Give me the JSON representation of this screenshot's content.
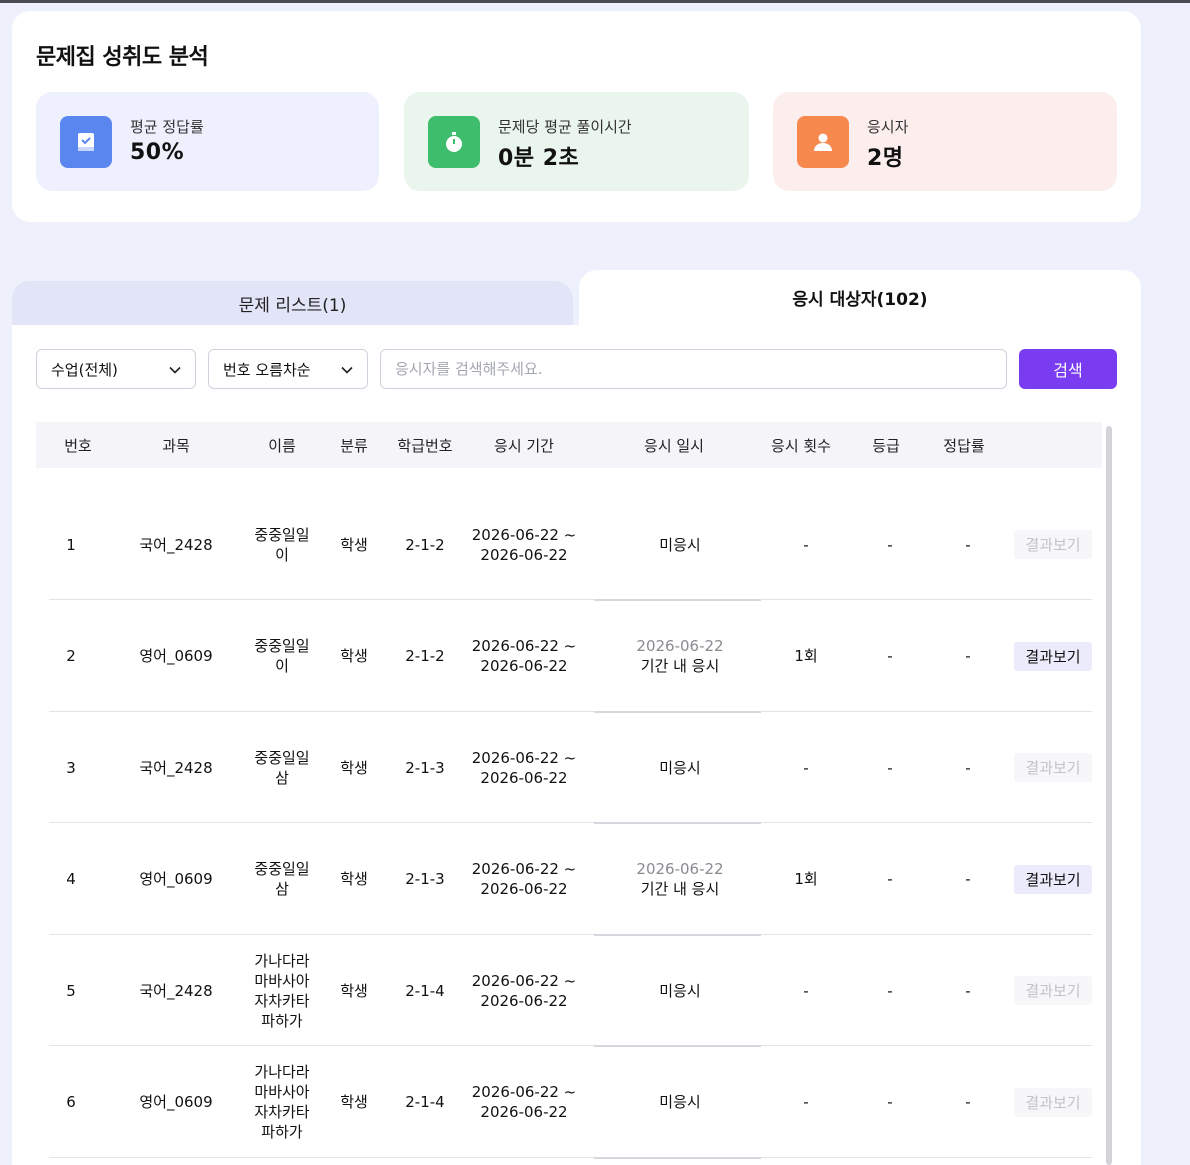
{
  "summary": {
    "title": "문제집 성취도 분석",
    "stats": [
      {
        "label": "평균 정답률",
        "value": "50%",
        "icon": "book-check-icon",
        "color": "#5a86f0"
      },
      {
        "label": "문제당 평균 풀이시간",
        "value": "0분 2초",
        "icon": "stopwatch-icon",
        "color": "#3ebd6c"
      },
      {
        "label": "응시자",
        "value": "2명",
        "icon": "person-icon",
        "color": "#f7884e"
      }
    ]
  },
  "tabs": [
    {
      "label": "문제 리스트(1)",
      "active": false
    },
    {
      "label": "응시 대상자(102)",
      "active": true
    }
  ],
  "filters": {
    "class_select": "수업(전체)",
    "sort_select": "번호 오름차순",
    "search_placeholder": "응시자를 검색해주세요.",
    "search_button": "검색"
  },
  "table": {
    "columns": [
      "번호",
      "과목",
      "이름",
      "분류",
      "학급번호",
      "응시 기간",
      "응시 일시",
      "응시 횟수",
      "등급",
      "정답률"
    ],
    "result_label": "결과보기",
    "rows": [
      {
        "no": "1",
        "subject": "국어_2428",
        "name": [
          "중중일일",
          "이"
        ],
        "type": "학생",
        "class_no": "2-1-2",
        "period": [
          "2026-06-22 ~",
          "2026-06-22"
        ],
        "taken": [
          "미응시"
        ],
        "taken_muted": false,
        "count": "-",
        "grade": "-",
        "rate": "-",
        "result_enabled": false
      },
      {
        "no": "2",
        "subject": "영어_0609",
        "name": [
          "중중일일",
          "이"
        ],
        "type": "학생",
        "class_no": "2-1-2",
        "period": [
          "2026-06-22 ~",
          "2026-06-22"
        ],
        "taken": [
          "2026-06-22",
          "기간 내 응시"
        ],
        "taken_muted": true,
        "count": "1회",
        "grade": "-",
        "rate": "-",
        "result_enabled": true
      },
      {
        "no": "3",
        "subject": "국어_2428",
        "name": [
          "중중일일",
          "삼"
        ],
        "type": "학생",
        "class_no": "2-1-3",
        "period": [
          "2026-06-22 ~",
          "2026-06-22"
        ],
        "taken": [
          "미응시"
        ],
        "taken_muted": false,
        "count": "-",
        "grade": "-",
        "rate": "-",
        "result_enabled": false
      },
      {
        "no": "4",
        "subject": "영어_0609",
        "name": [
          "중중일일",
          "삼"
        ],
        "type": "학생",
        "class_no": "2-1-3",
        "period": [
          "2026-06-22 ~",
          "2026-06-22"
        ],
        "taken": [
          "2026-06-22",
          "기간 내 응시"
        ],
        "taken_muted": true,
        "count": "1회",
        "grade": "-",
        "rate": "-",
        "result_enabled": true
      },
      {
        "no": "5",
        "subject": "국어_2428",
        "name": [
          "가나다라",
          "마바사아",
          "자차카타",
          "파하가"
        ],
        "type": "학생",
        "class_no": "2-1-4",
        "period": [
          "2026-06-22 ~",
          "2026-06-22"
        ],
        "taken": [
          "미응시"
        ],
        "taken_muted": false,
        "count": "-",
        "grade": "-",
        "rate": "-",
        "result_enabled": false
      },
      {
        "no": "6",
        "subject": "영어_0609",
        "name": [
          "가나다라",
          "마바사아",
          "자차카타",
          "파하가"
        ],
        "type": "학생",
        "class_no": "2-1-4",
        "period": [
          "2026-06-22 ~",
          "2026-06-22"
        ],
        "taken": [
          "미응시"
        ],
        "taken_muted": false,
        "count": "-",
        "grade": "-",
        "rate": "-",
        "result_enabled": false
      }
    ]
  }
}
